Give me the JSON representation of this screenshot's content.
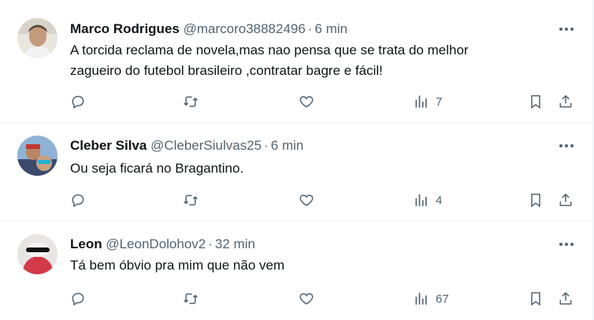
{
  "tweets": [
    {
      "display_name": "Marco Rodrigues",
      "handle": "@marcoro38882496",
      "time": "6 min",
      "text_lines": [
        "A torcida reclama de novela,mas nao pensa que se trata do melhor",
        "zagueiro do futebol brasileiro ,contratar bagre e fácil!"
      ],
      "views": "7"
    },
    {
      "display_name": "Cleber Silva",
      "handle": "@CleberSiulvas25",
      "time": "6 min",
      "text_lines": [
        "Ou seja ficará no Bragantino."
      ],
      "views": "4"
    },
    {
      "display_name": "Leon",
      "handle": "@LeonDolohov2",
      "time": "32 min",
      "text_lines": [
        "Tá bem óbvio pra mim que não vem"
      ],
      "views": "67"
    }
  ],
  "icons": {
    "reply": "reply-icon",
    "retweet": "retweet-icon",
    "like": "like-icon",
    "views": "views-icon",
    "bookmark": "bookmark-icon",
    "share": "share-icon",
    "more": "more-icon"
  },
  "colors": {
    "text": "#0f1419",
    "muted": "#536471",
    "divider": "#eff3f4"
  }
}
